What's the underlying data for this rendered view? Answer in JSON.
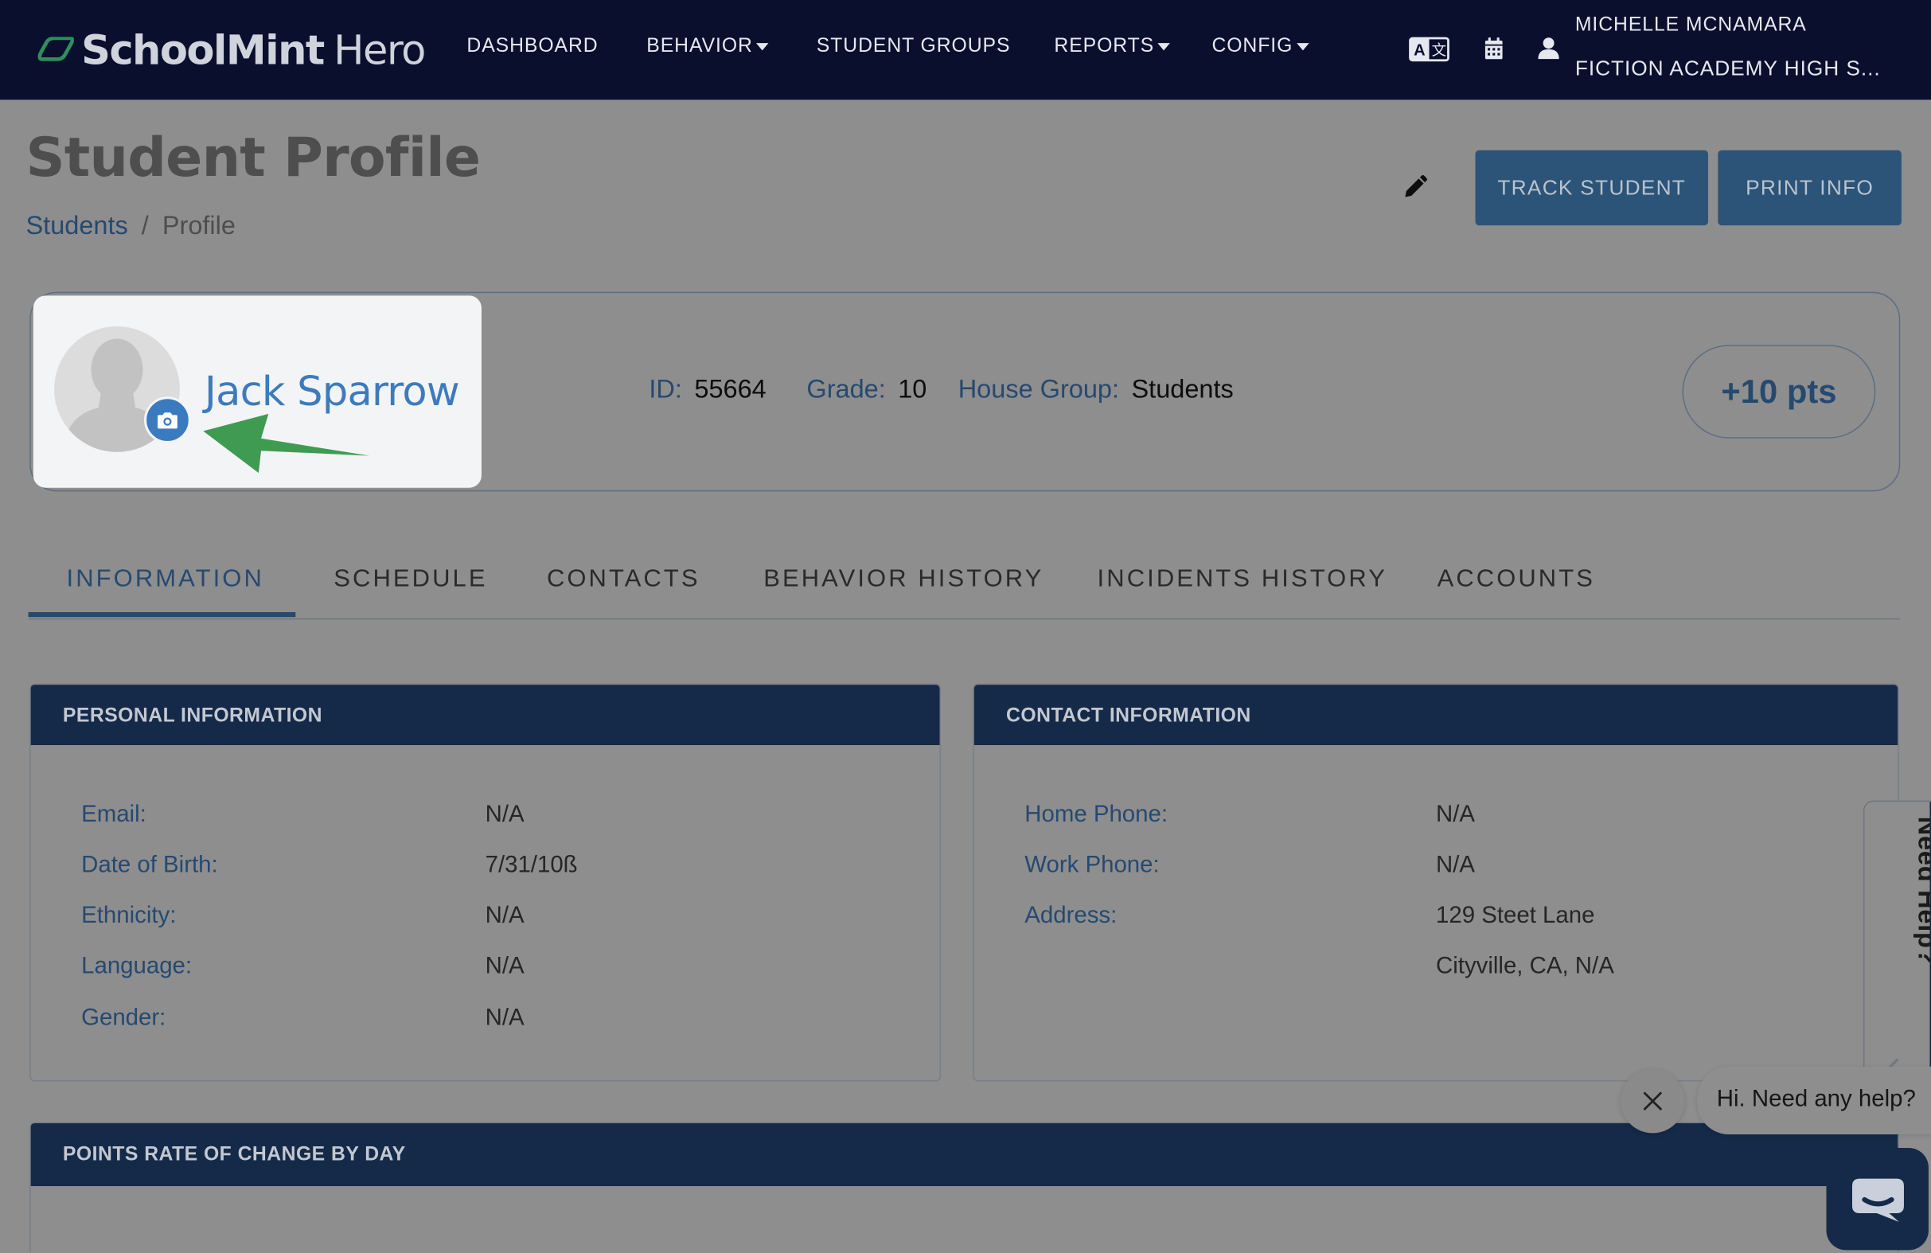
{
  "nav": {
    "logo_name": "SchoolMint",
    "logo_suffix": "Hero",
    "items": [
      {
        "label": "DASHBOARD"
      },
      {
        "label": "BEHAVIOR"
      },
      {
        "label": "STUDENT GROUPS"
      },
      {
        "label": "REPORTS"
      },
      {
        "label": "CONFIG"
      }
    ],
    "icons": [
      "translate-icon",
      "calendar-icon",
      "user-icon"
    ],
    "user_name": "MICHELLE MCNAMARA",
    "school_name": "FICTION ACADEMY HIGH S..."
  },
  "header": {
    "title": "Student Profile",
    "breadcrumb": {
      "link": "Students",
      "separator": "/",
      "current": "Profile"
    },
    "track_label": "TRACK STUDENT",
    "print_label": "PRINT INFO"
  },
  "student": {
    "name": "Jack Sparrow",
    "id_label": "ID:",
    "id_value": "55664",
    "grade_label": "Grade:",
    "grade_value": "10",
    "house_label": "House Group:",
    "house_value": "Students",
    "points": "+10 pts"
  },
  "tabs": [
    {
      "label": "INFORMATION",
      "active": true
    },
    {
      "label": "SCHEDULE"
    },
    {
      "label": "CONTACTS"
    },
    {
      "label": "BEHAVIOR HISTORY"
    },
    {
      "label": "INCIDENTS HISTORY"
    },
    {
      "label": "ACCOUNTS"
    }
  ],
  "personal": {
    "title": "PERSONAL INFORMATION",
    "rows": [
      {
        "label": "Email:",
        "value": "N/A"
      },
      {
        "label": "Date of Birth:",
        "value": "7/31/10ß"
      },
      {
        "label": "Ethnicity:",
        "value": "N/A"
      },
      {
        "label": "Language:",
        "value": "N/A"
      },
      {
        "label": "Gender:",
        "value": "N/A"
      }
    ]
  },
  "contact": {
    "title": "CONTACT INFORMATION",
    "rows": [
      {
        "label": "Home Phone:",
        "value": "N/A"
      },
      {
        "label": "Work Phone:",
        "value": "N/A"
      },
      {
        "label": "Address:",
        "value": "129 Steet Lane"
      },
      {
        "label": "",
        "value": "Cityville, CA, N/A"
      }
    ]
  },
  "points_panel": {
    "title": "POINTS RATE OF CHANGE BY DAY"
  },
  "help": {
    "side_label": "Need Help?",
    "chat_message": "Hi. Need any help?"
  },
  "colors": {
    "nav_bg": "#0b0f2e",
    "panel_head": "#152a49",
    "accent": "#3d7bbd",
    "button": "#2c5378",
    "arrow": "#3f9b52"
  }
}
